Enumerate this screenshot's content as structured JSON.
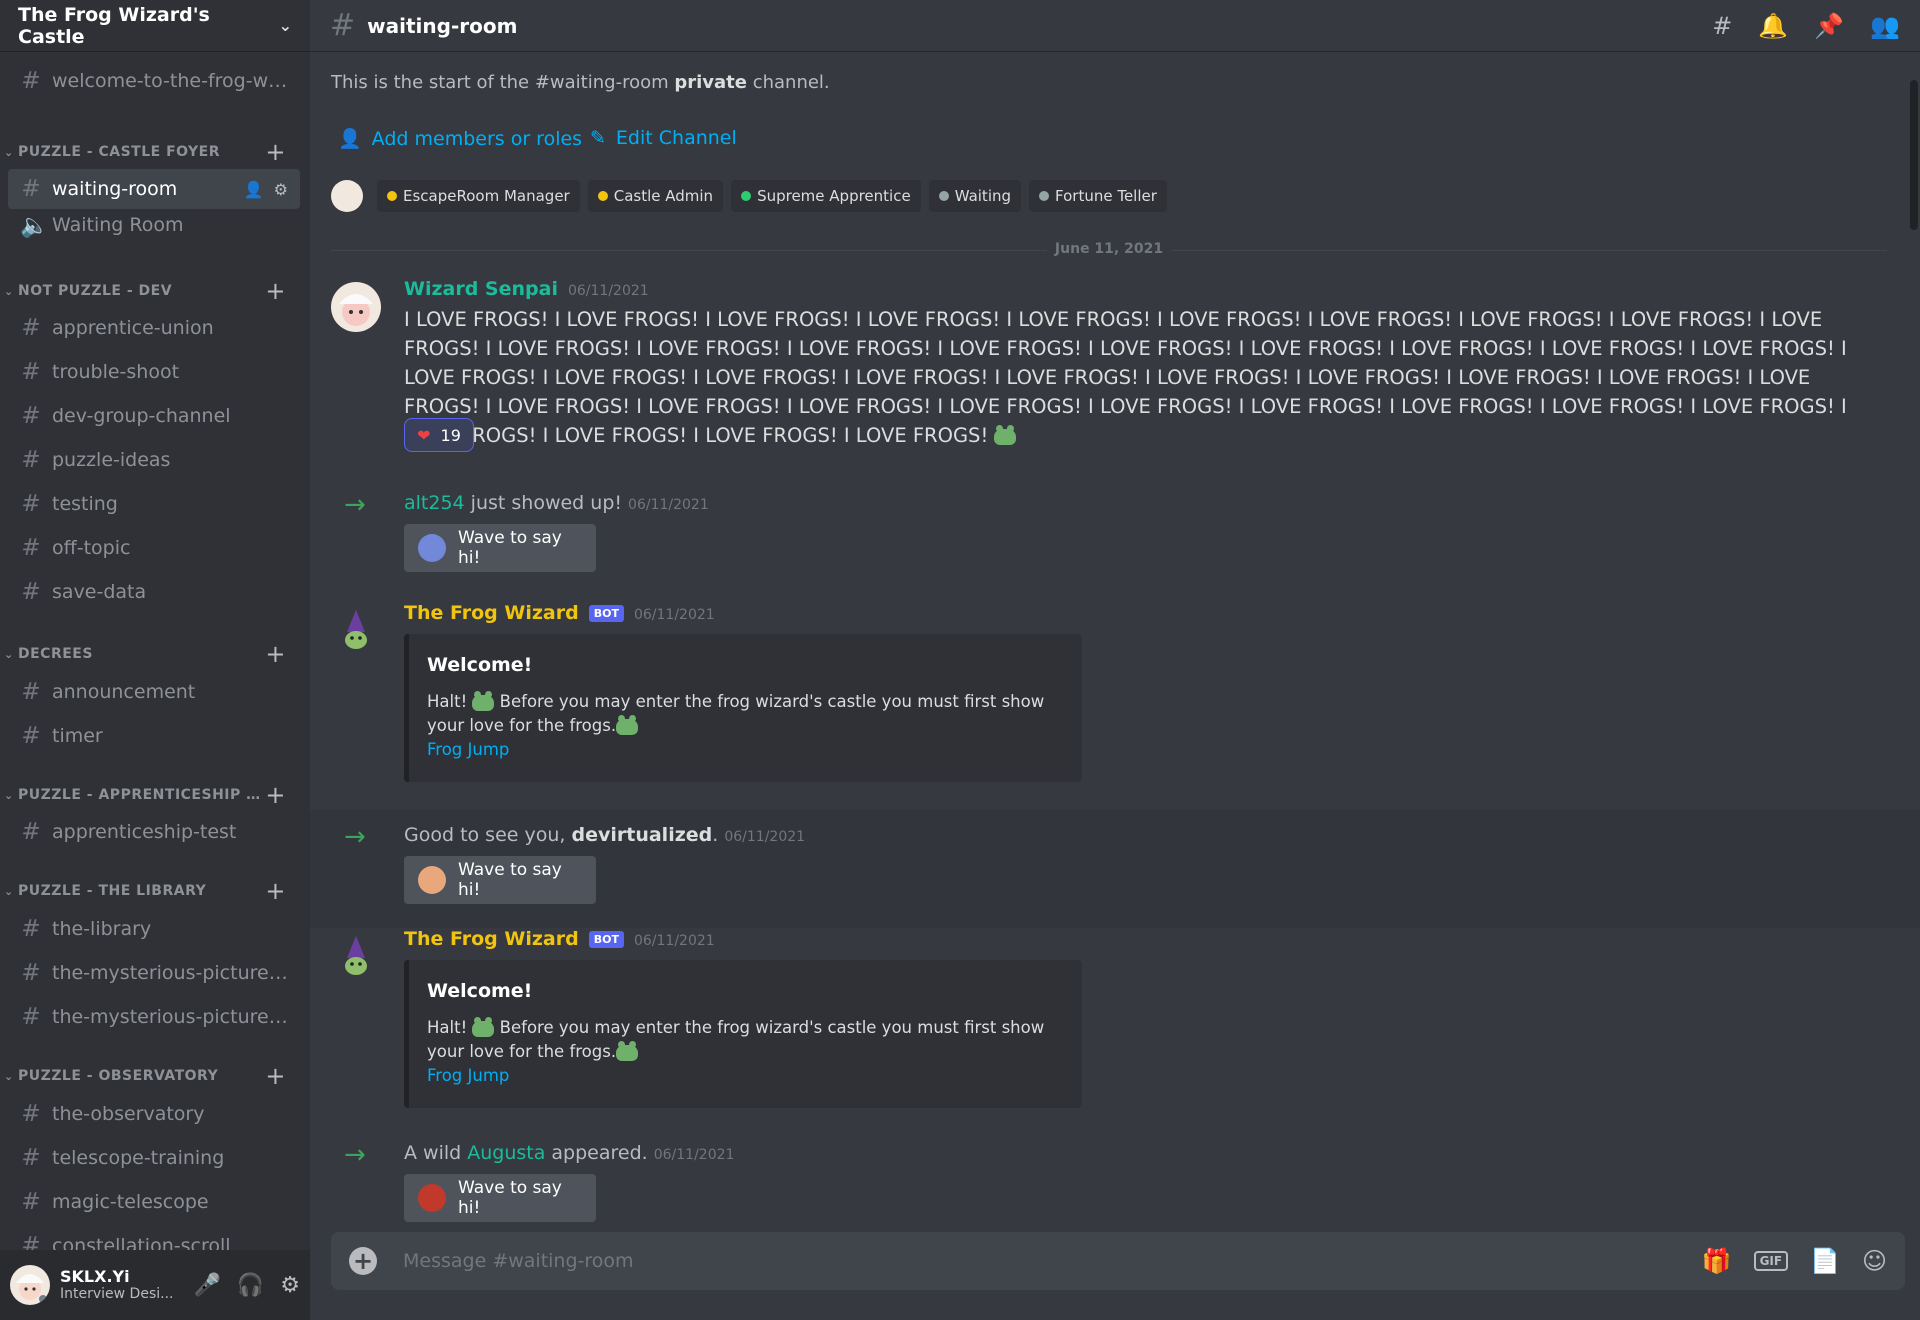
{
  "server": {
    "name": "The Frog Wizard's Castle"
  },
  "sidebar": {
    "top_channel": "welcome-to-the-frog-wiz...",
    "categories": [
      {
        "name": "PUZZLE - CASTLE FOYER",
        "channels": [
          "waiting-room",
          "Waiting Room"
        ]
      },
      {
        "name": "NOT PUZZLE - DEV",
        "channels": [
          "apprentice-union",
          "trouble-shoot",
          "dev-group-channel",
          "puzzle-ideas",
          "testing",
          "off-topic",
          "save-data"
        ]
      },
      {
        "name": "DECREES",
        "channels": [
          "announcement",
          "timer"
        ]
      },
      {
        "name": "PUZZLE - APPRENTICESHIP TE...",
        "channels": [
          "apprenticeship-test"
        ]
      },
      {
        "name": "PUZZLE - THE LIBRARY",
        "channels": [
          "the-library",
          "the-mysterious-pictures-...",
          "the-mysterious-picture-s..."
        ]
      },
      {
        "name": "PUZZLE - OBSERVATORY",
        "channels": [
          "the-observatory",
          "telescope-training",
          "magic-telescope",
          "constellation-scroll"
        ]
      }
    ]
  },
  "user": {
    "name": "SKLX.Yi",
    "status": "Interview Desi..."
  },
  "topbar": {
    "channel": "waiting-room"
  },
  "intro": {
    "prefix": "This is the start of the #waiting-room ",
    "bold": "private",
    "suffix": " channel."
  },
  "actions": {
    "add_members": "Add members or roles",
    "edit_channel": "Edit Channel"
  },
  "roles": [
    {
      "name": "EscapeRoom Manager",
      "color": "#f1c40f"
    },
    {
      "name": "Castle Admin",
      "color": "#f1c40f"
    },
    {
      "name": "Supreme Apprentice",
      "color": "#2ecc71"
    },
    {
      "name": "Waiting",
      "color": "#95a5a6"
    },
    {
      "name": "Fortune Teller",
      "color": "#95a5a6"
    }
  ],
  "date_divider": "June 11, 2021",
  "messages": {
    "m1": {
      "author": "Wizard Senpai",
      "author_color": "#1abc9c",
      "timestamp": "06/11/2021",
      "text": "I LOVE FROGS! I LOVE FROGS! I LOVE FROGS! I LOVE FROGS! I LOVE FROGS! I LOVE FROGS! I LOVE FROGS! I LOVE FROGS! I LOVE FROGS! I LOVE FROGS! I LOVE FROGS! I LOVE FROGS! I LOVE FROGS! I LOVE FROGS! I LOVE FROGS! I LOVE FROGS! I LOVE FROGS! I LOVE FROGS! I LOVE FROGS! I LOVE FROGS! I LOVE FROGS! I LOVE FROGS! I LOVE FROGS! I LOVE FROGS! I LOVE FROGS! I LOVE FROGS! I LOVE FROGS! I LOVE FROGS! I LOVE FROGS! I LOVE FROGS! I LOVE FROGS! I LOVE FROGS! I LOVE FROGS! I LOVE FROGS! I LOVE FROGS! I LOVE FROGS! I LOVE FROGS! I LOVE FROGS! I LOVE FROGS! I LOVE FROGS! I LOVE FROGS! I LOVE FROGS!",
      "reaction_count": "19"
    },
    "j1": {
      "user": "alt254",
      "text": " just showed up! ",
      "timestamp": "06/11/2021",
      "wave": "Wave to say hi!"
    },
    "b1": {
      "author": "The Frog Wizard",
      "bot": "BOT",
      "timestamp": "06/11/2021",
      "embed_title": "Welcome!",
      "embed_desc_1": "Halt! ",
      "embed_desc_2": " Before you may enter the frog wizard's castle you must first show your love for the frogs.",
      "embed_link": "Frog Jump"
    },
    "j2": {
      "prefix": "Good to see you, ",
      "user": "devirtualized",
      "suffix": ". ",
      "timestamp": "06/11/2021",
      "wave": "Wave to say hi!"
    },
    "b2": {
      "author": "The Frog Wizard",
      "bot": "BOT",
      "timestamp": "06/11/2021",
      "embed_title": "Welcome!",
      "embed_desc_1": "Halt! ",
      "embed_desc_2": " Before you may enter the frog wizard's castle you must first show your love for the frogs.",
      "embed_link": "Frog Jump"
    },
    "j3": {
      "prefix": "A wild ",
      "user": "Augusta",
      "suffix": " appeared. ",
      "timestamp": "06/11/2021",
      "wave": "Wave to say hi!"
    }
  },
  "composer": {
    "placeholder": "Message #waiting-room",
    "gif": "GIF"
  },
  "colors": {
    "bot_name": "#f1c40f",
    "accent": "#5865f2",
    "link": "#00aff4",
    "join_arrow": "#3ba55c"
  }
}
